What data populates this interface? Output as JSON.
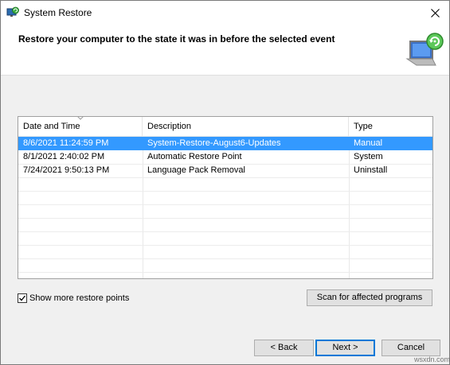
{
  "window": {
    "title": "System Restore",
    "app_icon": "system-restore-icon",
    "close_icon": "close-icon"
  },
  "header": {
    "text": "Restore your computer to the state it was in before the selected event",
    "graphic_icon": "restore-monitor-icon"
  },
  "table": {
    "columns": [
      "Date and Time",
      "Description",
      "Type"
    ],
    "sort_indicator_icon": "sort-arrow-icon",
    "rows": [
      {
        "date": "8/6/2021 11:24:59 PM",
        "description": "System-Restore-August6-Updates",
        "type": "Manual",
        "selected": true
      },
      {
        "date": "8/1/2021 2:40:02 PM",
        "description": "Automatic Restore Point",
        "type": "System",
        "selected": false
      },
      {
        "date": "7/24/2021 9:50:13 PM",
        "description": "Language Pack Removal",
        "type": "Uninstall",
        "selected": false
      }
    ]
  },
  "show_more": {
    "label": "Show more restore points",
    "checked": true
  },
  "buttons": {
    "scan": "Scan for affected programs",
    "back": "< Back",
    "next": "Next >",
    "cancel": "Cancel"
  },
  "watermark": "wsxdn.com",
  "colors": {
    "selection": "#3399ff",
    "default_button_border": "#0078d7",
    "dialog_background": "#f0f0f0"
  }
}
